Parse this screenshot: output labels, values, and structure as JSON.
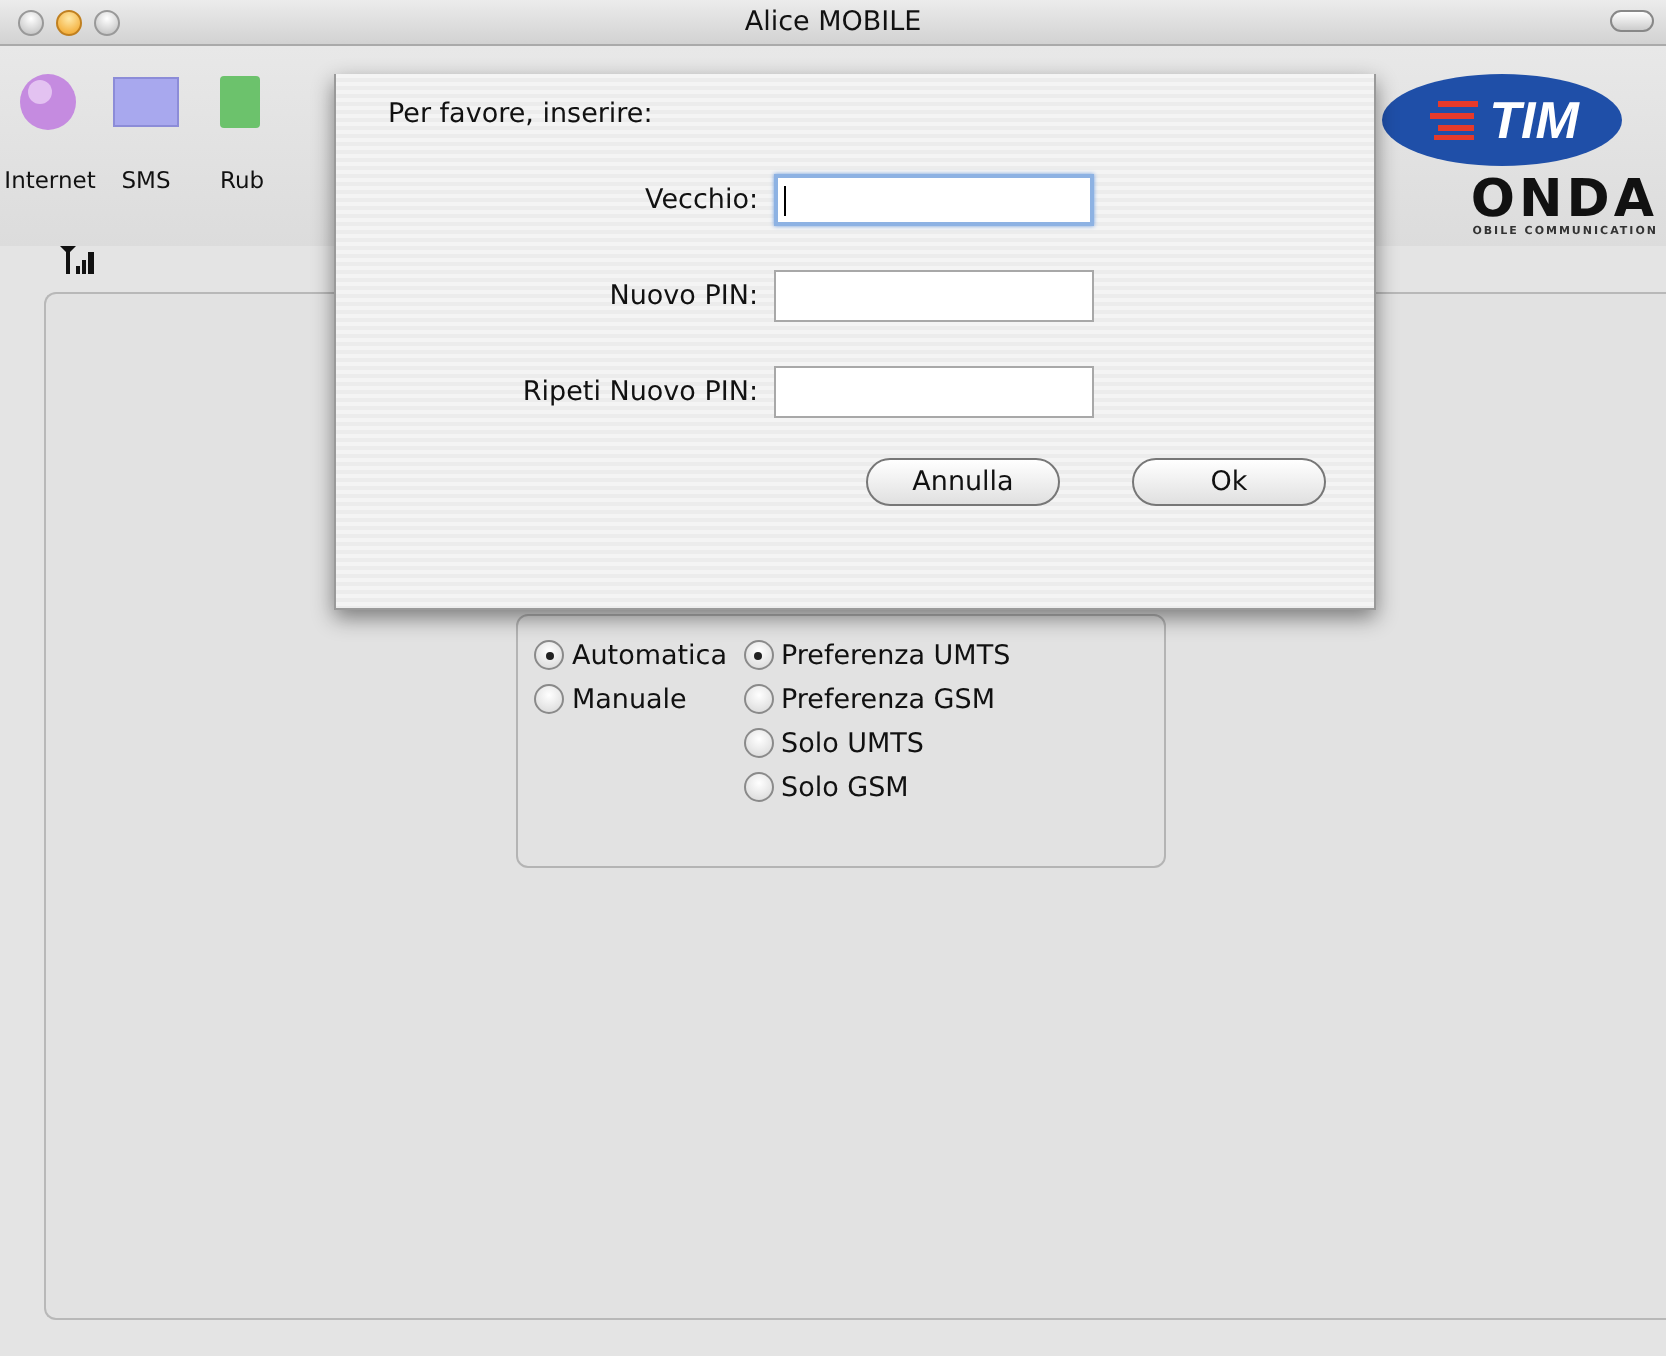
{
  "window": {
    "title": "Alice MOBILE"
  },
  "branding": {
    "operator_logo": "TIM",
    "maker_logo": "ONDA",
    "maker_tagline": "OBILE COMMUNICATION"
  },
  "toolbar": {
    "items": [
      {
        "label": "Internet",
        "kind": "globe"
      },
      {
        "label": "SMS",
        "kind": "envelope"
      },
      {
        "label": "Rub",
        "kind": "book"
      }
    ]
  },
  "network": {
    "mode_options": [
      {
        "label": "Automatica",
        "selected": true
      },
      {
        "label": "Manuale",
        "selected": false
      }
    ],
    "band_options": [
      {
        "label": "Preferenza UMTS",
        "selected": true
      },
      {
        "label": "Preferenza GSM",
        "selected": false
      },
      {
        "label": "Solo UMTS",
        "selected": false
      },
      {
        "label": "Solo GSM",
        "selected": false
      }
    ]
  },
  "dialog": {
    "prompt": "Per favore, inserire:",
    "fields": [
      {
        "label": "Vecchio:",
        "focused": true
      },
      {
        "label": "Nuovo PIN:",
        "focused": false
      },
      {
        "label": "Ripeti Nuovo PIN:",
        "focused": false
      }
    ],
    "buttons": [
      {
        "label": "Annulla"
      },
      {
        "label": "Ok"
      }
    ]
  }
}
